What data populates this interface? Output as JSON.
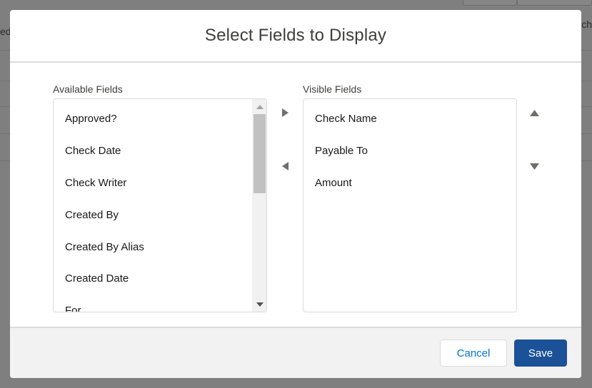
{
  "background": {
    "left_text": "ed",
    "right_text": "rch"
  },
  "modal": {
    "title": "Select Fields to Display",
    "available": {
      "label": "Available Fields",
      "options": [
        "Approved?",
        "Check Date",
        "Check Writer",
        "Created By",
        "Created By Alias",
        "Created Date",
        "For"
      ]
    },
    "visible": {
      "label": "Visible Fields",
      "options": [
        "Check Name",
        "Payable To",
        "Amount"
      ]
    },
    "icons": {
      "move_right": "right-triangle-icon",
      "move_left": "left-triangle-icon",
      "move_up": "up-triangle-icon",
      "move_down": "down-triangle-icon"
    },
    "footer": {
      "cancel_label": "Cancel",
      "save_label": "Save"
    },
    "colors": {
      "brand_button": "#1b5297",
      "link_blue": "#0176d3",
      "footer_bg": "#f3f2f2",
      "overlay": "#7f7f7f"
    }
  }
}
